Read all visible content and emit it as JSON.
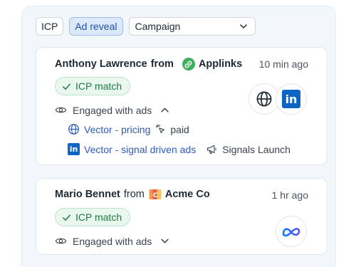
{
  "filters": {
    "icp_label": "ICP",
    "ad_reveal_label": "Ad reveal",
    "campaign_value": "Campaign"
  },
  "cards": [
    {
      "person": "Anthony Lawrence",
      "from": "from",
      "company": "Applinks",
      "time": "10 min ago",
      "badge": "ICP match",
      "engaged": "Engaged with ads",
      "rows": [
        {
          "link": "Vector - pricing",
          "extra": "paid"
        },
        {
          "link": "Vector - signal driven ads",
          "extra": "Signals Launch"
        }
      ]
    },
    {
      "person": "Mario Bennet",
      "from": "from",
      "company": "Acme Co",
      "time": "1 hr ago",
      "badge": "ICP match",
      "engaged": "Engaged with ads"
    }
  ],
  "colors": {
    "accent": "#2e5bb8",
    "linkedin": "#0a66c2",
    "applinks": "#3bb25a",
    "badge_bg": "#eaf7ee",
    "badge_text": "#1f7a43",
    "meta_gradient": [
      "#0a7cff",
      "#5b4dff"
    ]
  }
}
